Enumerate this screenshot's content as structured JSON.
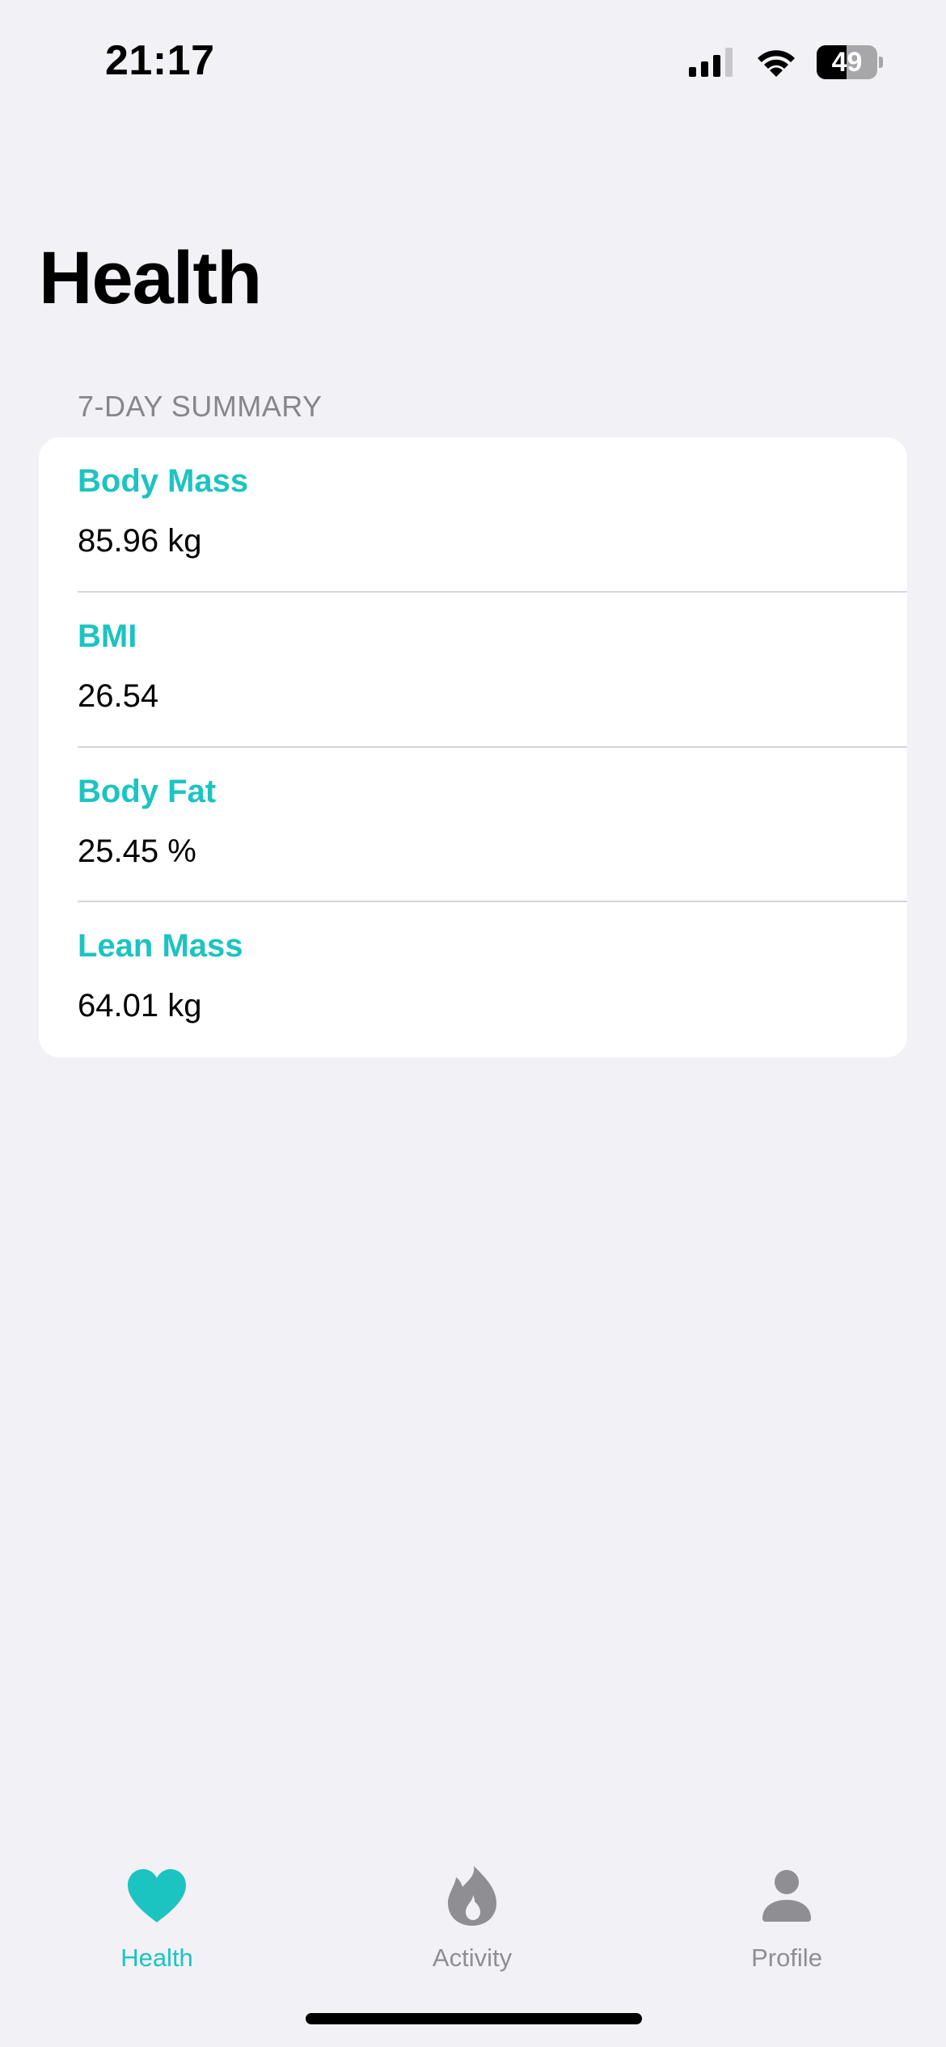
{
  "status_bar": {
    "time": "21:17",
    "battery_level": "49",
    "battery_fraction": 0.49
  },
  "page": {
    "title": "Health"
  },
  "summary": {
    "header": "7-DAY SUMMARY",
    "metrics": [
      {
        "label": "Body Mass",
        "value": "85.96 kg"
      },
      {
        "label": "BMI",
        "value": "26.54"
      },
      {
        "label": "Body Fat",
        "value": "25.45 %"
      },
      {
        "label": "Lean Mass",
        "value": "64.01 kg"
      }
    ]
  },
  "tab_bar": {
    "tabs": [
      {
        "label": "Health",
        "icon": "heart-icon",
        "selected": true
      },
      {
        "label": "Activity",
        "icon": "flame-icon",
        "selected": false
      },
      {
        "label": "Profile",
        "icon": "person-icon",
        "selected": false
      }
    ]
  },
  "colors": {
    "accent": "#1CC4C1",
    "background": "#F2F1F6",
    "card": "#FFFFFF",
    "secondary_text": "#86868B",
    "inactive_tab": "#8E8E93"
  }
}
